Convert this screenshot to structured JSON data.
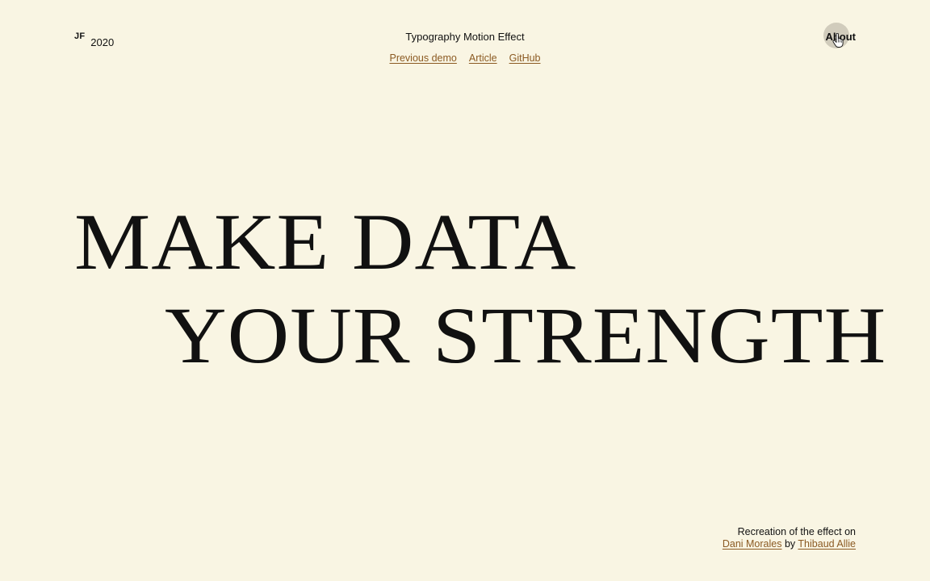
{
  "header": {
    "logo_mark": "JF",
    "logo_year": "2020",
    "title": "Typography Motion Effect",
    "links": [
      "Previous demo",
      "Article",
      "GitHub"
    ],
    "about_label": "About"
  },
  "headline": {
    "line1": "MAKE DATA",
    "line2": "YOUR STRENGTH"
  },
  "credits": {
    "intro": "Recreation of the effect on",
    "site_link": "Dani Morales",
    "by": "by",
    "author_link": "Thibaud Allie"
  },
  "colors": {
    "background": "#f9f5e3",
    "text": "#111111",
    "link": "#8b5a22"
  },
  "icons": {
    "cursor": "hand-pointer-icon"
  }
}
